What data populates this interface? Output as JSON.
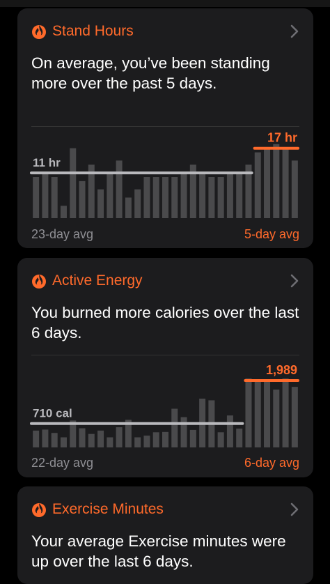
{
  "colors": {
    "accent": "#ff6a2b",
    "bar": "#4a4a4c",
    "avg_line": "#b9b9bd",
    "card": "#1c1c1e",
    "muted": "#8e8e93"
  },
  "cards": [
    {
      "title": "Stand Hours",
      "icon": "flame-icon",
      "text": "On average, you’ve been standing more over the past 5 days.",
      "chart_data": {
        "type": "bar",
        "left_label": "11 hr",
        "right_label": "17 hr",
        "left_avg": 11,
        "right_avg": 17,
        "ylim": [
          0,
          20
        ],
        "bars": [
          10,
          11,
          10,
          3,
          17,
          9,
          13,
          7,
          11,
          14,
          5,
          7,
          10,
          10,
          10,
          10,
          11,
          13,
          11,
          10,
          10,
          11,
          11,
          13,
          16,
          17,
          18,
          17,
          14
        ],
        "highlight_count": 5,
        "left_footer": "23-day avg",
        "right_footer": "5-day avg"
      }
    },
    {
      "title": "Active Energy",
      "icon": "flame-icon",
      "text": "You burned more calories over the last 6 days.",
      "chart_data": {
        "type": "bar",
        "left_label": "710 cal",
        "right_label": "1,989",
        "left_avg": 710,
        "right_avg": 1989,
        "ylim": [
          0,
          2300
        ],
        "bars": [
          500,
          530,
          430,
          300,
          800,
          570,
          400,
          500,
          300,
          600,
          820,
          300,
          350,
          450,
          460,
          1150,
          900,
          520,
          1450,
          1400,
          450,
          950,
          560,
          2050,
          2000,
          2000,
          1720,
          2050,
          1800
        ],
        "highlight_count": 6,
        "left_footer": "22-day avg",
        "right_footer": "6-day avg"
      }
    },
    {
      "title": "Exercise Minutes",
      "icon": "flame-icon",
      "text": "Your average Exercise minutes were up over the last 6 days."
    }
  ]
}
